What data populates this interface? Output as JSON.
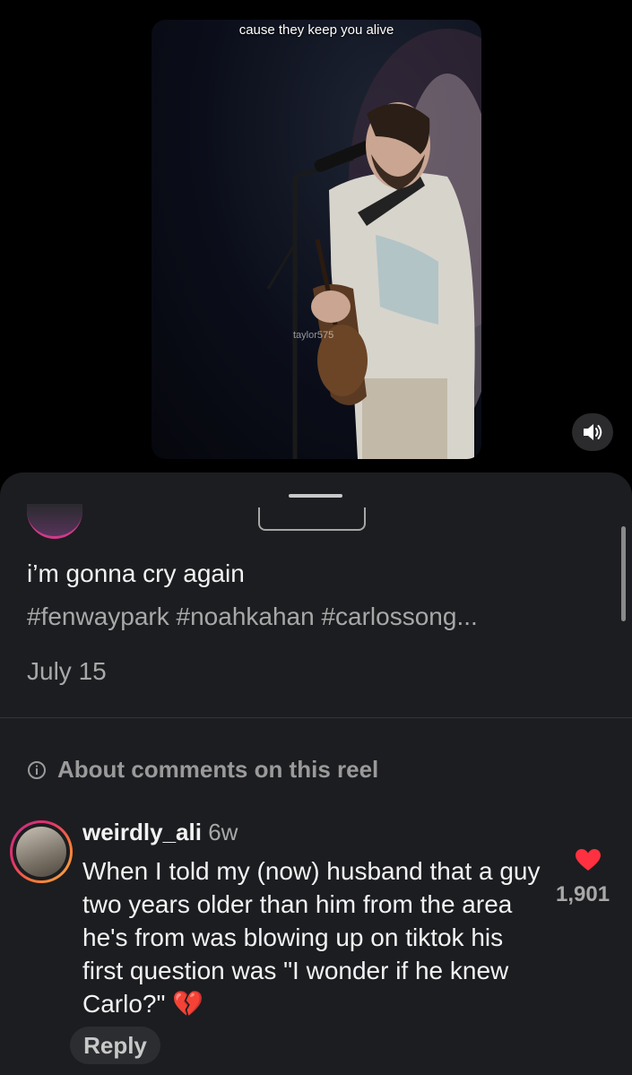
{
  "reel": {
    "caption_overlay": "cause they keep you alive",
    "watermark": "taylor575"
  },
  "controls": {
    "mute_icon": "speaker-icon"
  },
  "post": {
    "caption": "i’m gonna cry again",
    "hashtags": "#fenwaypark #noahkahan #carlossong...",
    "date": "July 15"
  },
  "comments_notice": {
    "icon": "info-icon",
    "label": "About comments on this reel"
  },
  "comment": {
    "username": "weirdly_ali",
    "age": "6w",
    "text": "When I told my (now) husband that a guy two years older than him from the area he's from was blowing up on tiktok his first question was \"I wonder if he knew Carlo?\" 💔",
    "likes": "1,901",
    "like_color": "#ff3040",
    "reply_label": "Reply"
  }
}
